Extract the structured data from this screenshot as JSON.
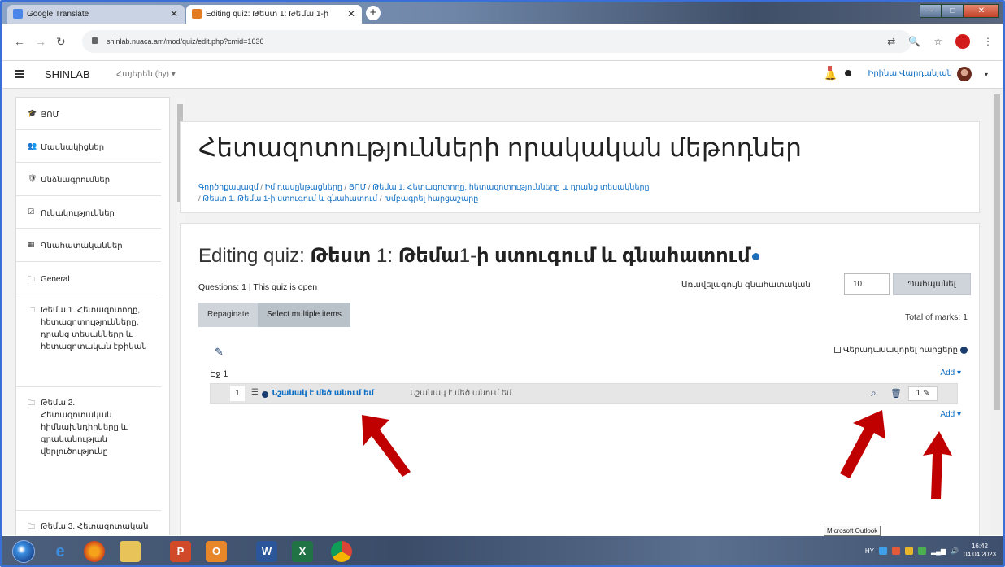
{
  "browser": {
    "tabs": [
      {
        "title": "Google Translate",
        "active": false
      },
      {
        "title": "Editing quiz: Թեստ 1: Թեմա 1-ի",
        "active": true
      }
    ],
    "url": "shinlab.nuaca.am/mod/quiz/edit.php?cmid=1636",
    "new_tab_label": "+",
    "window_controls": {
      "minimize": "–",
      "maximize": "□",
      "close": "✕"
    }
  },
  "navbar": {
    "brand": "SHINLAB",
    "language": "Հայերեն (hy) ▾",
    "user_name": "Իրինա Վարդանյան",
    "caret": "▾"
  },
  "drawer": {
    "items": [
      {
        "icon": "graduation-cap-icon",
        "glyph": "🎓",
        "label": "ՅՈՄ"
      },
      {
        "icon": "users-icon",
        "glyph": "👥",
        "label": "Մասնակիցներ"
      },
      {
        "icon": "shield-icon",
        "glyph": "🛡",
        "label": "Անձնագրումներ"
      },
      {
        "icon": "check-icon",
        "glyph": "☑",
        "label": "Ունակություններ"
      },
      {
        "icon": "grades-icon",
        "glyph": "▦",
        "label": "Գնահատականներ"
      },
      {
        "icon": "folder-icon",
        "glyph": "🗀",
        "label": "General"
      },
      {
        "icon": "folder-icon",
        "glyph": "🗀",
        "label": "Թեմա 1. Հետազոտողը, հետազոտությունները, դրանց տեսակները և հետազոտական էթիկան"
      },
      {
        "icon": "folder-icon",
        "glyph": "🗀",
        "label": "Թեմա 2. Հետազոտական հիմնախնդիրները և գրականության վերլուծությունը"
      },
      {
        "icon": "folder-icon",
        "glyph": "🗀",
        "label": "Թեմա 3. Հետազոտական"
      }
    ]
  },
  "header": {
    "title": "Հետազոտությունների որակական մեթոդներ",
    "breadcrumbs_line1": [
      "Գործիքակազմ",
      "Իմ դասընթացները",
      "ՅՈՄ",
      "Թեմա 1. Հետազոտողը, հետազոտությունները և դրանց տեսակները"
    ],
    "breadcrumbs_line2": [
      "Թեստ 1. Թեմա 1-ի ստուգում և գնահատում",
      "Խմբագրել հարցաշարը"
    ],
    "separator": "/"
  },
  "quiz": {
    "editing_prefix": "Editing quiz:",
    "title_bold_1": "Թեստ",
    "title_num_1": "1:",
    "title_bold_2": "Թեմա",
    "title_num_2": "1-",
    "title_rest": "ի ստուգում և գնահատում",
    "questions_info": "Questions: 1 | This quiz is open",
    "max_grade_label": "Առավելագույն գնահատական",
    "max_grade_value": "10",
    "save_label": "Պահպանել",
    "repaginate_label": "Repaginate",
    "select_multiple_label": "Select multiple items",
    "total_marks": "Total of marks: 1",
    "shuffle_label": "Վերադասավորել հարցերը",
    "page_label": "Էջ 1",
    "add_label": "Add ▾",
    "question": {
      "number": "1",
      "name": "Նշանակ է մեծ անում եմ",
      "text": "Նշանակ է մեծ անում եմ",
      "mark": "1"
    }
  },
  "tooltip": "Microsoft Outlook",
  "taskbar": {
    "apps": [
      "ie",
      "firefox",
      "explorer",
      "powerpoint",
      "outlook",
      "word",
      "excel",
      "chrome"
    ],
    "lang": "HY",
    "time": "16:42",
    "date": "04.04.2023"
  }
}
